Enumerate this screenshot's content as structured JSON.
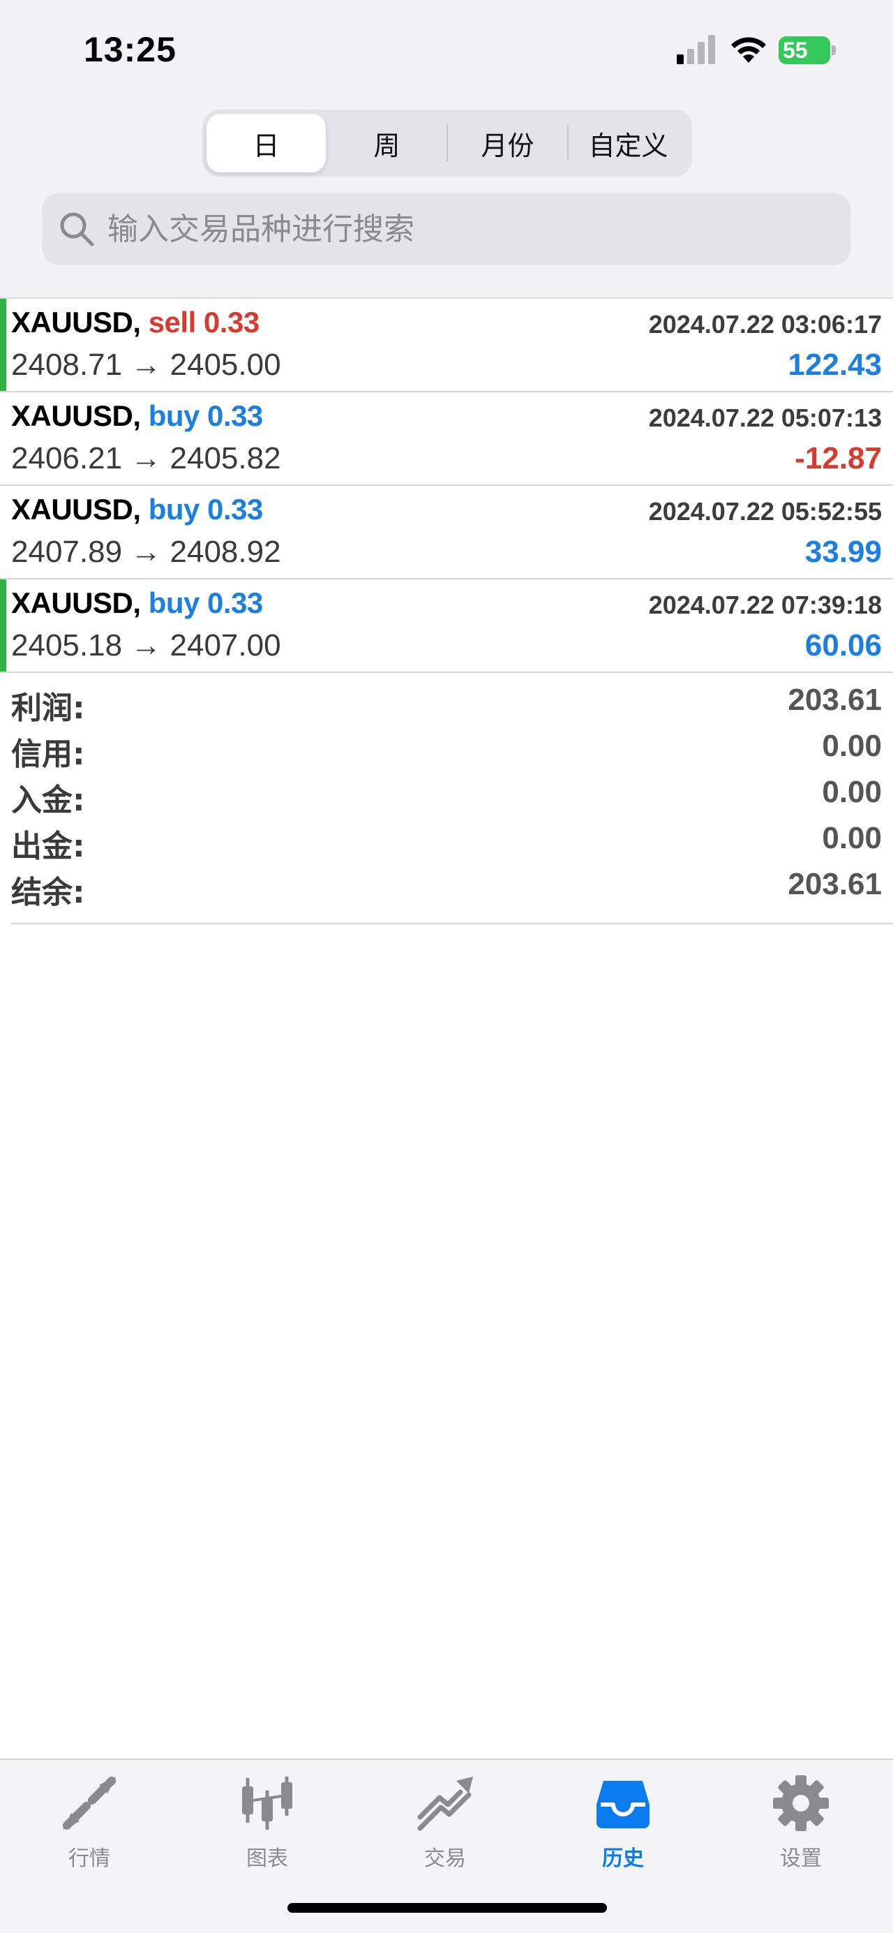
{
  "status_bar": {
    "time": "13:25",
    "battery": "55"
  },
  "period_tabs": [
    {
      "label": "日",
      "active": true
    },
    {
      "label": "周",
      "active": false
    },
    {
      "label": "月份",
      "active": false
    },
    {
      "label": "自定义",
      "active": false
    }
  ],
  "search": {
    "placeholder": "输入交易品种进行搜索",
    "value": ""
  },
  "deals": [
    {
      "symbol": "XAUUSD,",
      "direction": "sell 0.33",
      "type": "sell",
      "time": "2024.07.22 03:06:17",
      "prices": "2408.71 → 2405.00",
      "profit": "122.43",
      "profit_sign": "pos"
    },
    {
      "symbol": "XAUUSD,",
      "direction": "buy 0.33",
      "type": "buy",
      "time": "2024.07.22 05:07:13",
      "prices": "2406.21 → 2405.82",
      "profit": "-12.87",
      "profit_sign": "neg"
    },
    {
      "symbol": "XAUUSD,",
      "direction": "buy 0.33",
      "type": "buy",
      "time": "2024.07.22 05:52:55",
      "prices": "2407.89 → 2408.92",
      "profit": "33.99",
      "profit_sign": "pos"
    },
    {
      "symbol": "XAUUSD,",
      "direction": "buy 0.33",
      "type": "buy",
      "time": "2024.07.22 07:39:18",
      "prices": "2405.18 → 2407.00",
      "profit": "60.06",
      "profit_sign": "pos"
    }
  ],
  "summary": [
    {
      "label": "利润:",
      "value": "203.61"
    },
    {
      "label": "信用:",
      "value": "0.00"
    },
    {
      "label": "入金:",
      "value": "0.00"
    },
    {
      "label": "出金:",
      "value": "0.00"
    },
    {
      "label": "结余:",
      "value": "203.61"
    }
  ],
  "tabbar": [
    {
      "label": "行情",
      "icon": "quotes-arrows-icon",
      "active": false
    },
    {
      "label": "图表",
      "icon": "candlestick-chart-icon",
      "active": false
    },
    {
      "label": "交易",
      "icon": "trade-trend-icon",
      "active": false
    },
    {
      "label": "历史",
      "icon": "history-inbox-icon",
      "active": true
    },
    {
      "label": "设置",
      "icon": "gear-icon",
      "active": false
    }
  ],
  "colors": {
    "accent": "#0a7cf0",
    "buy": "#1a7fe0",
    "sell": "#d83a2e",
    "row_marker": "#2fb344",
    "battery": "#34c759"
  }
}
